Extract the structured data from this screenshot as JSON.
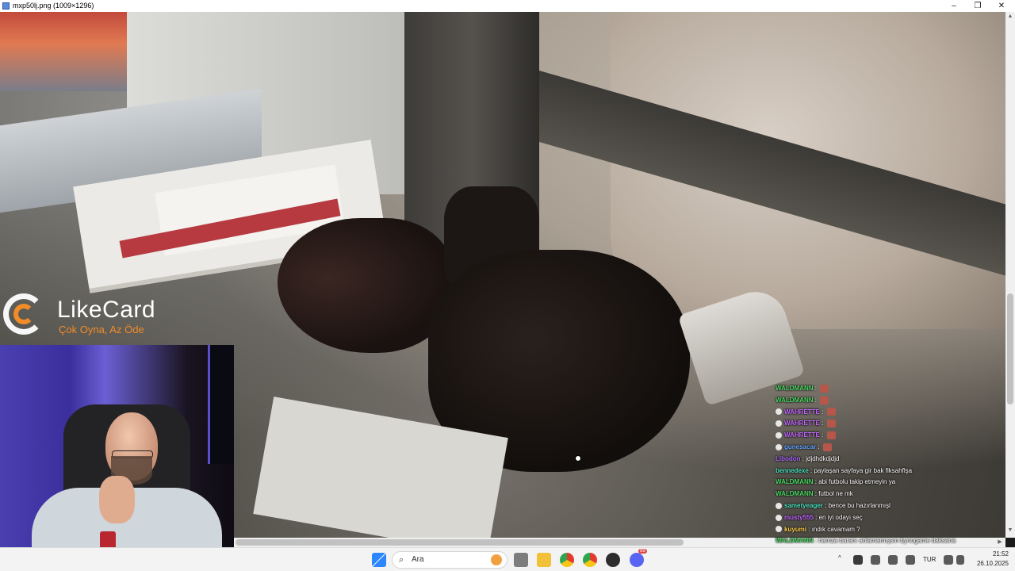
{
  "window": {
    "title": "mxp50lj.png (1009×1296)",
    "minimize_glyph": "–",
    "maximize_glyph": "❐",
    "close_glyph": "✕"
  },
  "overlay": {
    "brand": "LikeCard",
    "tagline": "Çok Oyna, Az Öde"
  },
  "chat": {
    "messages": [
      {
        "user": "WALDMANN",
        "text": "",
        "color": "#4cd964",
        "badge": false,
        "emote": true
      },
      {
        "user": "WALDMANN",
        "text": "",
        "color": "#4cd964",
        "badge": false,
        "emote": true
      },
      {
        "user": "WAHRETTE",
        "text": "",
        "color": "#c46bff",
        "badge": true,
        "emote": true
      },
      {
        "user": "WAHRETTE",
        "text": "",
        "color": "#c46bff",
        "badge": true,
        "emote": true
      },
      {
        "user": "WAHRETTE",
        "text": "",
        "color": "#c46bff",
        "badge": true,
        "emote": true
      },
      {
        "user": "gunesacar",
        "text": "",
        "color": "#68a8ff",
        "badge": true,
        "emote": true
      },
      {
        "user": "Libodon",
        "text": "jdjdhdkdjdjd",
        "color": "#b06bff",
        "badge": false,
        "emote": false
      },
      {
        "user": "bennedexe",
        "text": "paylaşan sayfaya gir bak flksahflşa",
        "color": "#50e3c2",
        "badge": false,
        "emote": false
      },
      {
        "user": "WALDMANN",
        "text": "abi futbolu takip etmeyin ya",
        "color": "#4cd964",
        "badge": false,
        "emote": false
      },
      {
        "user": "WALDMANN",
        "text": "futbol ne mk",
        "color": "#4cd964",
        "badge": false,
        "emote": false
      },
      {
        "user": "sametyeager",
        "text": "bence bu hazırlanmışl",
        "color": "#50e3c2",
        "badge": true,
        "emote": false
      },
      {
        "user": "musty555",
        "text": "en iyi odayı seç",
        "color": "#c46bff",
        "badge": true,
        "emote": false
      },
      {
        "user": "kuyumi",
        "text": "ındık cavamam ?",
        "color": "#ffd34d",
        "badge": true,
        "emote": false
      },
      {
        "user": "WALDMANN",
        "text": "hamza baranı anlamamışsın bynogame baksana",
        "color": "#4cd964",
        "badge": false,
        "emote": false
      }
    ]
  },
  "taskbar": {
    "search_placeholder": "Ara",
    "search_glyph": "⌕",
    "language": "TUR",
    "time": "21:52",
    "date": "26.10.2025",
    "discord_badge": "99",
    "tray_chevron": "^"
  },
  "scroll": {
    "up_arrow": "▲",
    "down_arrow": "▼",
    "left_arrow": "◀",
    "right_arrow": "▶"
  }
}
